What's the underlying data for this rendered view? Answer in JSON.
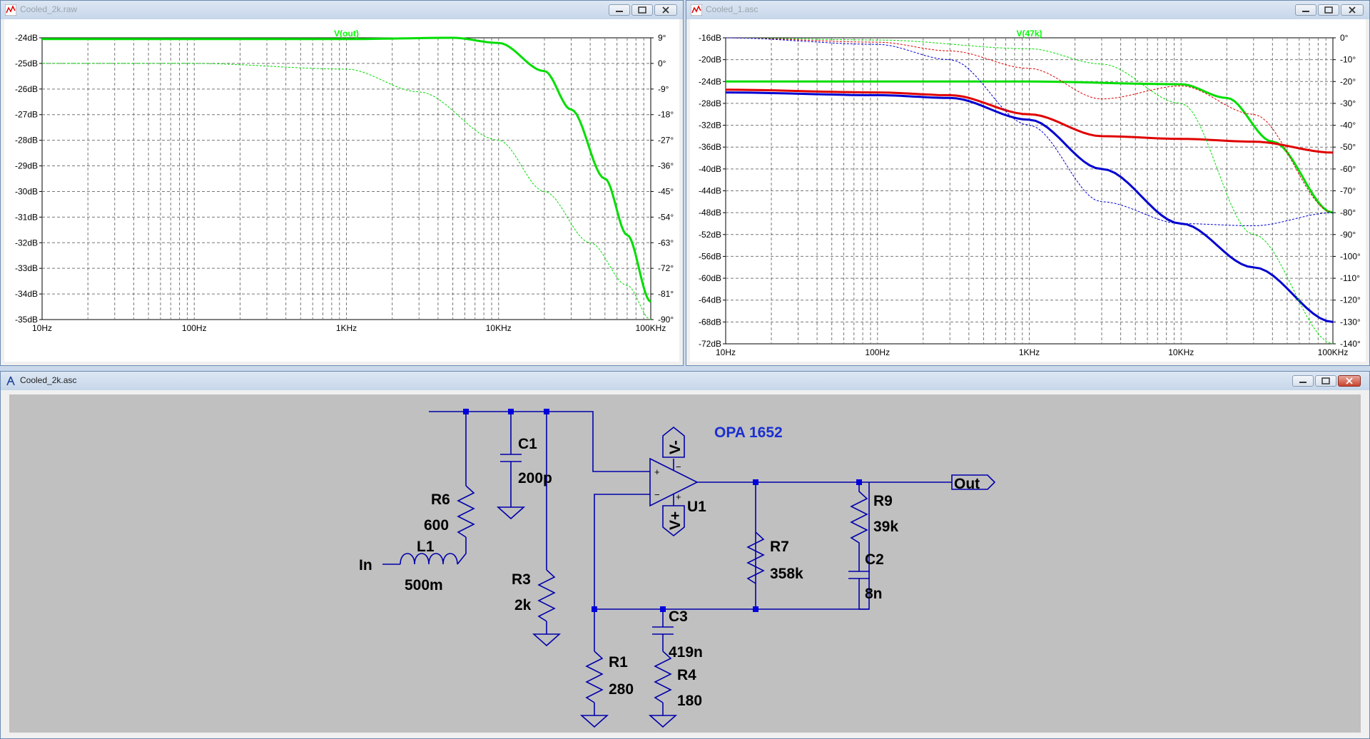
{
  "windows": {
    "plot1": {
      "title": "Cooled_2k.raw"
    },
    "plot2": {
      "title": "Cooled_1.asc"
    },
    "schematic": {
      "title": "Cooled_2k.asc"
    }
  },
  "plot1": {
    "trace_label": "V(out)",
    "trace_color": "#00ff00",
    "left_ticks": [
      "-24dB",
      "-25dB",
      "-26dB",
      "-27dB",
      "-28dB",
      "-29dB",
      "-30dB",
      "-31dB",
      "-32dB",
      "-33dB",
      "-34dB",
      "-35dB"
    ],
    "right_ticks": [
      "9°",
      "0°",
      "-9°",
      "-18°",
      "-27°",
      "-36°",
      "-45°",
      "-54°",
      "-63°",
      "-72°",
      "-81°",
      "-90°"
    ],
    "x_ticks": [
      "10Hz",
      "100Hz",
      "1KHz",
      "10KHz",
      "100KHz"
    ]
  },
  "plot2": {
    "trace_label": "V(47k)",
    "trace_color": "#00ff00",
    "left_ticks": [
      "-16dB",
      "-20dB",
      "-24dB",
      "-28dB",
      "-32dB",
      "-36dB",
      "-40dB",
      "-44dB",
      "-48dB",
      "-52dB",
      "-56dB",
      "-60dB",
      "-64dB",
      "-68dB",
      "-72dB"
    ],
    "right_ticks": [
      "0°",
      "-10°",
      "-20°",
      "-30°",
      "-40°",
      "-50°",
      "-60°",
      "-70°",
      "-80°",
      "-90°",
      "-100°",
      "-110°",
      "-120°",
      "-130°",
      "-140°"
    ],
    "x_ticks": [
      "10Hz",
      "100Hz",
      "1KHz",
      "10KHz",
      "100KHz"
    ],
    "series_colors": [
      "#00dd00",
      "#e00000",
      "#0000d0"
    ]
  },
  "chart_data": [
    {
      "type": "line",
      "x_scale": "log",
      "xlim": [
        10,
        100000
      ],
      "ylim": [
        -35,
        -24
      ],
      "y2lim": [
        -90,
        9
      ],
      "series": [
        {
          "name": "V(out)",
          "axis": "magnitude_dB",
          "x": [
            10,
            100,
            1000,
            5000,
            10000,
            20000,
            30000,
            50000,
            70000,
            100000
          ],
          "values": [
            -24.05,
            -24.05,
            -24.05,
            -24.0,
            -24.2,
            -25.3,
            -26.8,
            -29.5,
            -31.7,
            -34.3
          ]
        },
        {
          "name": "V(out)",
          "axis": "phase_deg",
          "x": [
            10,
            100,
            1000,
            3000,
            10000,
            20000,
            40000,
            70000,
            100000
          ],
          "values": [
            0,
            0,
            -2,
            -10,
            -27,
            -45,
            -63,
            -78,
            -90
          ]
        }
      ]
    },
    {
      "type": "line",
      "x_scale": "log",
      "xlim": [
        10,
        100000
      ],
      "ylim": [
        -72,
        -16
      ],
      "y2lim": [
        -140,
        0
      ],
      "series": [
        {
          "axis": "magnitude_dB",
          "color": "green",
          "x": [
            10,
            100,
            1000,
            10000,
            20000,
            40000,
            100000
          ],
          "values": [
            -24,
            -24,
            -24,
            -24.5,
            -27,
            -35,
            -48
          ]
        },
        {
          "axis": "magnitude_dB",
          "color": "red",
          "x": [
            10,
            100,
            300,
            1000,
            3000,
            10000,
            30000,
            100000
          ],
          "values": [
            -25.5,
            -26,
            -26.5,
            -30,
            -34,
            -34.5,
            -35,
            -37
          ]
        },
        {
          "axis": "magnitude_dB",
          "color": "blue",
          "x": [
            10,
            100,
            300,
            1000,
            3000,
            10000,
            30000,
            100000
          ],
          "values": [
            -26,
            -26.5,
            -27,
            -31,
            -40,
            -50,
            -58,
            -68
          ]
        },
        {
          "axis": "phase_deg",
          "color": "green",
          "x": [
            10,
            100,
            1000,
            3000,
            10000,
            30000,
            100000
          ],
          "values": [
            0,
            -1,
            -5,
            -12,
            -30,
            -90,
            -140
          ]
        },
        {
          "axis": "phase_deg",
          "color": "red",
          "x": [
            10,
            100,
            300,
            1000,
            3000,
            10000,
            30000,
            100000
          ],
          "values": [
            0,
            -2,
            -6,
            -14,
            -28,
            -22,
            -35,
            -80
          ]
        },
        {
          "axis": "phase_deg",
          "color": "blue",
          "x": [
            10,
            100,
            300,
            1000,
            3000,
            10000,
            30000,
            100000
          ],
          "values": [
            0,
            -3,
            -10,
            -40,
            -75,
            -85,
            -86,
            -80
          ]
        }
      ]
    }
  ],
  "schematic": {
    "title_label": "OPA 1652",
    "components": {
      "C1": {
        "ref": "C1",
        "value": "200p"
      },
      "R6": {
        "ref": "R6",
        "value": "600"
      },
      "L1": {
        "ref": "L1",
        "value": "500m"
      },
      "R3": {
        "ref": "R3",
        "value": "2k"
      },
      "R1": {
        "ref": "R1",
        "value": "280"
      },
      "C3": {
        "ref": "C3",
        "value": "419n"
      },
      "R4": {
        "ref": "R4",
        "value": "180"
      },
      "R7": {
        "ref": "R7",
        "value": "358k"
      },
      "R9": {
        "ref": "R9",
        "value": "39k"
      },
      "C2": {
        "ref": "C2",
        "value": "8n"
      },
      "U1": {
        "ref": "U1"
      }
    },
    "in_label": "In",
    "out_label": "Out",
    "vminus": "V-",
    "vplus": "V+",
    "plus_sign": "+",
    "minus_sign": "−",
    "wire_color": "#0000aa",
    "text_color": "#000000",
    "title_color": "#1a2fd0"
  }
}
